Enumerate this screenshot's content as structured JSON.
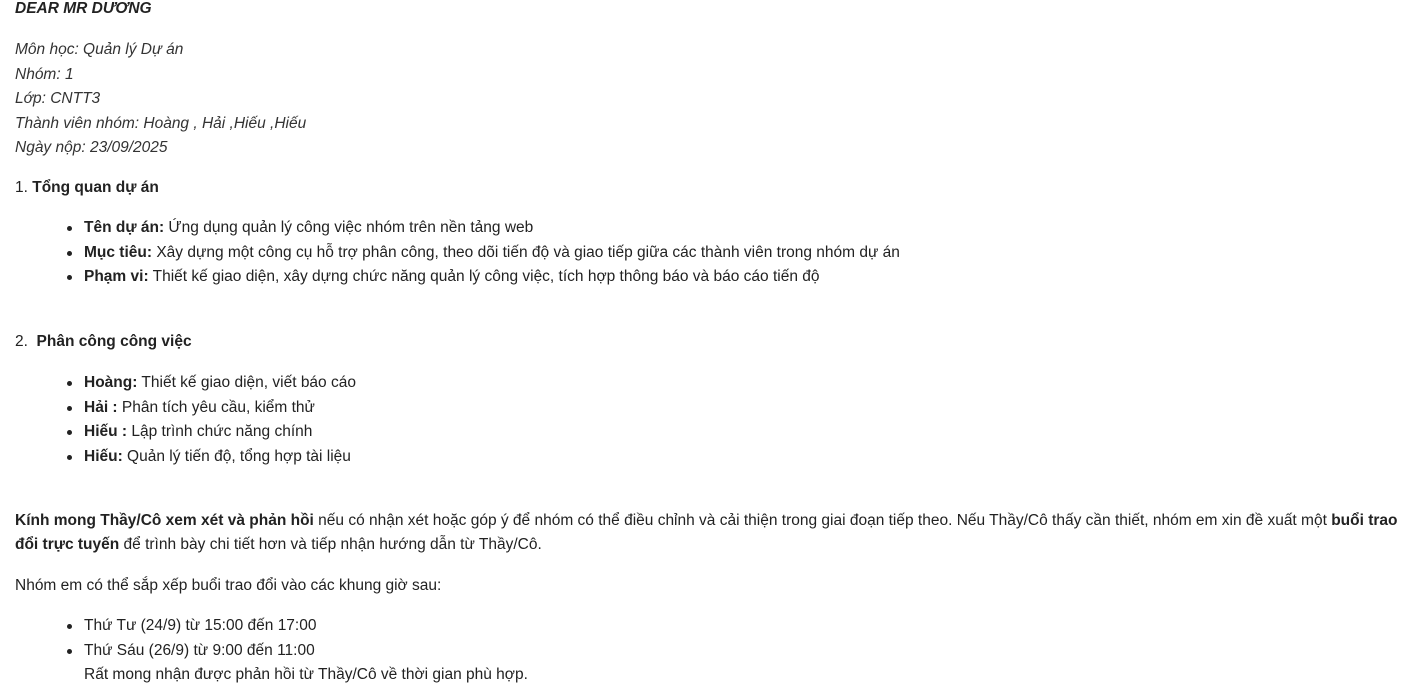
{
  "greeting": "DEAR MR DƯƠNG",
  "meta": [
    "Môn học: Quản lý Dự án",
    "Nhóm: 1",
    "Lớp: CNTT3",
    "Thành viên nhóm: Hoàng , Hải ,Hiếu ,Hiếu",
    "Ngày nộp: 23/09/2025"
  ],
  "section1": {
    "number": "1. ",
    "title": "Tổng quan dự án",
    "items": [
      {
        "label": "Tên dự án:",
        "text": " Ứng dụng quản lý công việc nhóm trên nền tảng web"
      },
      {
        "label": "Mục tiêu:",
        "text": " Xây dựng một công cụ hỗ trợ phân công, theo dõi tiến độ và giao tiếp giữa các thành viên trong nhóm dự án"
      },
      {
        "label": "Phạm vi:",
        "text": " Thiết kế giao diện, xây dựng chức năng quản lý công việc, tích hợp thông báo và báo cáo tiến độ"
      }
    ]
  },
  "section2": {
    "number": "2.  ",
    "title": "Phân công công việc",
    "items": [
      {
        "label": "Hoàng:",
        "text": " Thiết kế giao diện, viết báo cáo"
      },
      {
        "label": "Hải :",
        "text": " Phân tích yêu cầu, kiểm thử"
      },
      {
        "label": "Hiếu :",
        "text": " Lập trình chức năng chính"
      },
      {
        "label": "Hiếu:",
        "text": " Quản lý tiến độ, tổng hợp tài liệu"
      }
    ]
  },
  "closing": {
    "bold1": "Kính mong Thầy/Cô xem xét và phản hồi",
    "text1": " nếu có nhận xét hoặc góp ý để nhóm có thể điều chỉnh và cải thiện trong giai đoạn tiếp theo. Nếu Thầy/Cô thấy cần thiết, nhóm em xin đề xuất một ",
    "bold2": "buổi trao đổi trực tuyến",
    "text2": " để trình bày chi tiết hơn và tiếp nhận hướng dẫn từ Thầy/Cô."
  },
  "schedule_intro": "Nhóm em có thể sắp xếp buổi trao đổi vào các khung giờ sau:",
  "schedule": [
    "Thứ Tư (24/9) từ 15:00 đến 17:00",
    "Thứ Sáu (26/9) từ 9:00 đến 11:00"
  ],
  "final_line": "Rất mong nhận được phản hồi từ Thầy/Cô về thời gian phù hợp."
}
